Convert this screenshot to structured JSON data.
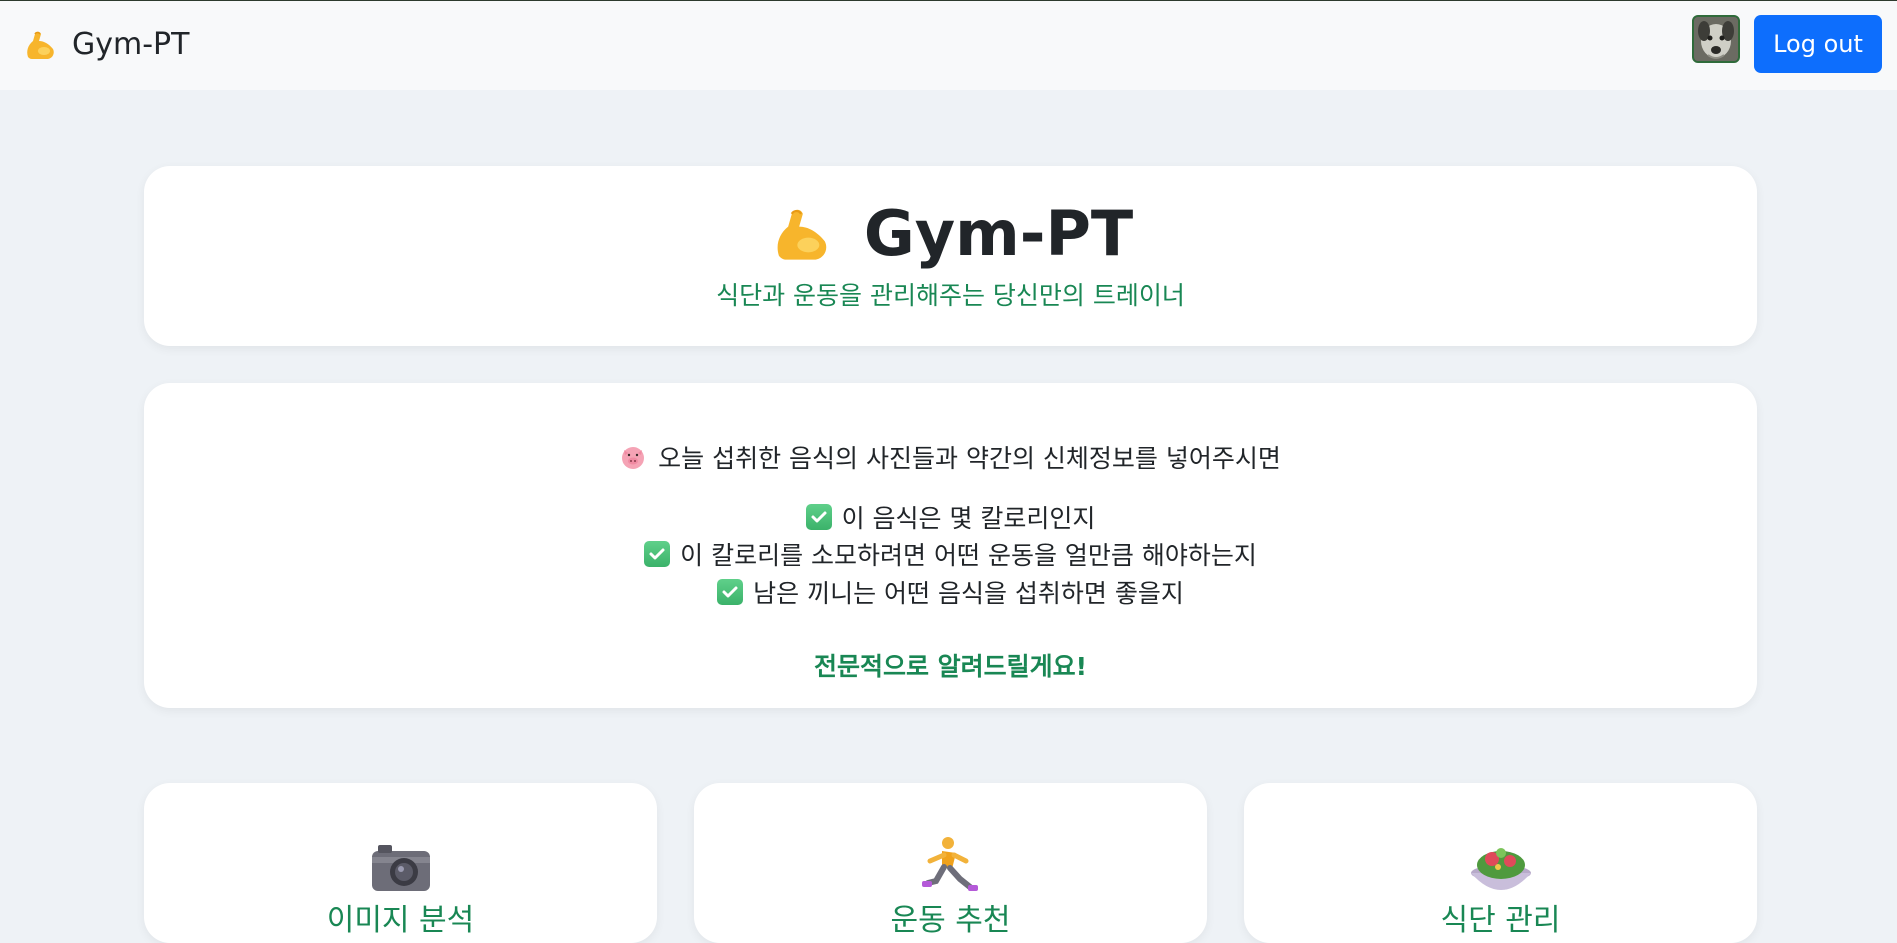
{
  "navbar": {
    "brand_text": "Gym-PT",
    "brand_icon": "flexed-biceps-icon",
    "avatar_icon": "dog-avatar",
    "logout_label": "Log out",
    "logout_color": "#0d6efd"
  },
  "hero": {
    "icon": "flexed-biceps-icon",
    "title": "Gym-PT",
    "subtitle": "식단과 운동을 관리해주는 당신만의 트레이너"
  },
  "intro": {
    "icon": "pig-face-icon",
    "lead": "오늘 섭취한 음식의 사진들과 약간의 신체정보를 넣어주시면",
    "checks": [
      "이 음식은 몇 칼로리인지",
      "이 칼로리를 소모하려면 어떤 운동을 얼만큼 해야하는지",
      "남은 끼니는 어떤 음식을 섭취하면 좋을지"
    ],
    "closing": "전문적으로 알려드릴게요!"
  },
  "features": [
    {
      "icon": "camera-icon",
      "label": "이미지 분석"
    },
    {
      "icon": "running-person-icon",
      "label": "운동 추천"
    },
    {
      "icon": "salad-icon",
      "label": "식단 관리"
    }
  ],
  "colors": {
    "accent_green": "#198754",
    "background": "#eef2f6",
    "primary": "#0d6efd"
  }
}
